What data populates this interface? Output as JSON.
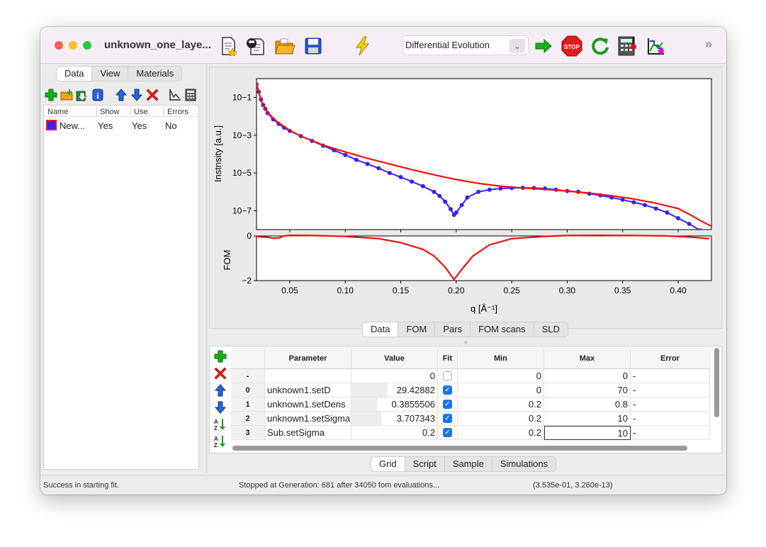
{
  "window": {
    "title": "unknown_one_laye...",
    "colors": {
      "close": "#ff5f57",
      "minimize": "#febc2e",
      "zoom": "#28c840",
      "data_line": "#3b1ff0",
      "fit_line": "#ee1111"
    }
  },
  "toolbar": {
    "icons": [
      "new-file-icon",
      "open-example-icon",
      "open-folder-icon",
      "save-icon",
      "lightning-icon",
      "arrow-right-icon",
      "stop-icon",
      "refresh-icon",
      "calculator-icon",
      "sld-icon"
    ],
    "algorithm": "Differential Evolution",
    "more": "»"
  },
  "left_panel": {
    "tabs": [
      "Data",
      "View",
      "Materials"
    ],
    "active_tab": "Data",
    "tools": [
      "add-icon",
      "folder-add-icon",
      "import-icon",
      "info-icon",
      "up-arrow-icon",
      "down-arrow-icon",
      "delete-icon",
      "plot-icon",
      "calculator-icon"
    ],
    "columns": [
      "Name",
      "Show",
      "Use",
      "Errors"
    ],
    "rows": [
      {
        "name": "New...",
        "show": "Yes",
        "use": "Yes",
        "errors": "No"
      }
    ]
  },
  "chart_data": [
    {
      "type": "line",
      "ylabel": "Instnsity [a.u.]",
      "y_scale": "log",
      "ylim": [
        1e-08,
        1
      ],
      "y_ticks": [
        "10−1",
        "10−3",
        "10−5",
        "10−7"
      ],
      "xlim": [
        0.02,
        0.43
      ],
      "series": [
        {
          "role": "data",
          "x": [
            0.02,
            0.022,
            0.024,
            0.026,
            0.028,
            0.03,
            0.035,
            0.04,
            0.045,
            0.05,
            0.06,
            0.07,
            0.08,
            0.09,
            0.1,
            0.11,
            0.12,
            0.13,
            0.14,
            0.15,
            0.16,
            0.17,
            0.18,
            0.185,
            0.19,
            0.195,
            0.198,
            0.2,
            0.205,
            0.21,
            0.22,
            0.23,
            0.24,
            0.25,
            0.26,
            0.27,
            0.28,
            0.29,
            0.3,
            0.31,
            0.32,
            0.33,
            0.34,
            0.35,
            0.36,
            0.37,
            0.38,
            0.39,
            0.4,
            0.41,
            0.42,
            0.43
          ],
          "y": [
            0.5,
            0.2,
            0.08,
            0.04,
            0.025,
            0.015,
            0.007,
            0.004,
            0.0025,
            0.0017,
            0.0009,
            0.0005,
            0.00028,
            0.00016,
            9e-05,
            5e-05,
            3e-05,
            1.8e-05,
            1e-05,
            6e-06,
            3.5e-06,
            2e-06,
            1e-06,
            6e-07,
            3e-07,
            1.2e-07,
            6e-08,
            8e-08,
            2e-07,
            5e-07,
            1e-06,
            1.3e-06,
            1.5e-06,
            1.6e-06,
            1.65e-06,
            1.6e-06,
            1.5e-06,
            1.3e-06,
            1.1e-06,
            1e-06,
            8e-07,
            6.5e-07,
            5e-07,
            3.8e-07,
            2.8e-07,
            2e-07,
            1.3e-07,
            8e-08,
            4e-08,
            2e-08,
            9e-09,
            4e-09
          ]
        },
        {
          "role": "fit",
          "x": [
            0.02,
            0.022,
            0.024,
            0.026,
            0.028,
            0.03,
            0.035,
            0.04,
            0.05,
            0.06,
            0.08,
            0.1,
            0.12,
            0.14,
            0.16,
            0.18,
            0.2,
            0.22,
            0.24,
            0.26,
            0.28,
            0.3,
            0.32,
            0.34,
            0.36,
            0.38,
            0.4,
            0.41,
            0.42,
            0.43
          ],
          "y": [
            0.6,
            0.2,
            0.08,
            0.04,
            0.025,
            0.016,
            0.008,
            0.0045,
            0.0018,
            0.0009,
            0.0003,
            0.00013,
            6e-05,
            3e-05,
            1.5e-05,
            8e-06,
            4.5e-06,
            2.8e-06,
            2e-06,
            1.6e-06,
            1.35e-06,
            1.1e-06,
            8.5e-07,
            6.2e-07,
            4.2e-07,
            2.5e-07,
            1.3e-07,
            6.5e-08,
            3e-08,
            1.5e-08
          ]
        }
      ]
    },
    {
      "type": "line",
      "xlabel": "q [Å⁻¹]",
      "ylabel": "FOM",
      "ylim": [
        -2,
        0
      ],
      "y_ticks": [
        "0",
        "−2"
      ],
      "xlim": [
        0.02,
        0.43
      ],
      "x_ticks": [
        0.05,
        0.1,
        0.15,
        0.2,
        0.25,
        0.3,
        0.35,
        0.4
      ],
      "x_tick_labels": [
        "0.05",
        "0.10",
        "0.15",
        "0.20",
        "0.25",
        "0.30",
        "0.35",
        "0.40"
      ],
      "series": [
        {
          "x": [
            0.02,
            0.03,
            0.035,
            0.04,
            0.045,
            0.05,
            0.07,
            0.1,
            0.13,
            0.15,
            0.17,
            0.18,
            0.19,
            0.198,
            0.205,
            0.215,
            0.23,
            0.25,
            0.28,
            0.3,
            0.33,
            0.36,
            0.39,
            0.41,
            0.428
          ],
          "y": [
            -0.03,
            -0.06,
            -0.1,
            -0.09,
            0.0,
            0.03,
            0.02,
            -0.02,
            -0.12,
            -0.3,
            -0.6,
            -0.9,
            -1.4,
            -1.95,
            -1.5,
            -0.9,
            -0.4,
            -0.12,
            -0.02,
            0.02,
            0.03,
            0.02,
            0.0,
            -0.05,
            -0.12
          ]
        }
      ]
    }
  ],
  "plot_tabs": [
    "Data",
    "FOM",
    "Pars",
    "FOM scans",
    "SLD"
  ],
  "plot_active_tab": "Data",
  "grid": {
    "tools": [
      "add-icon",
      "delete-icon",
      "up-arrow-icon",
      "down-arrow-icon",
      "sort-icon",
      "sort-icon"
    ],
    "columns": [
      "Parameter",
      "Value",
      "Fit",
      "Min",
      "Max",
      "Error"
    ],
    "rows": [
      {
        "idx": "-",
        "param": "",
        "value": "0",
        "fit": false,
        "min": "0",
        "max": "0",
        "error": "-"
      },
      {
        "idx": "0",
        "param": "unknown1.setD",
        "value": "29.42882",
        "fit": true,
        "min": "0",
        "max": "70",
        "error": "-"
      },
      {
        "idx": "1",
        "param": "unknown1.setDens",
        "value": "0.3855506",
        "fit": true,
        "min": "0.2",
        "max": "0.8",
        "error": "-"
      },
      {
        "idx": "2",
        "param": "unknown1.setSigma",
        "value": "3.707343",
        "fit": true,
        "min": "0.2",
        "max": "10",
        "error": "-"
      },
      {
        "idx": "3",
        "param": "Sub.setSigma",
        "value": "0.2",
        "fit": true,
        "min": "0.2",
        "max": "10",
        "error": "-"
      }
    ]
  },
  "bottom_tabs": [
    "Grid",
    "Script",
    "Sample",
    "Simulations"
  ],
  "bottom_active_tab": "Grid",
  "status": {
    "left": "Success in starting fit.",
    "center": "Stopped at Generation: 681 after 34050 fom evaluations...",
    "right": "(3.535e-01, 3.260e-13)"
  }
}
